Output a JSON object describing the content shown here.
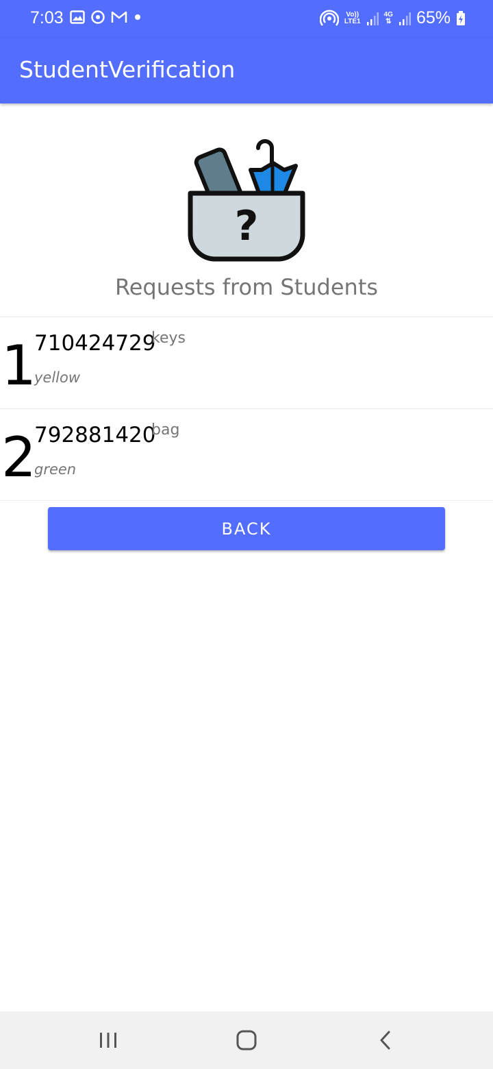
{
  "status_bar": {
    "time": "7:03",
    "left_icons": [
      "gallery-icon",
      "sync-icon",
      "gmail-icon",
      "dot-icon"
    ],
    "right_icons": [
      "hotspot-icon",
      "volte-icon",
      "signal-icon",
      "4g-icon",
      "signal-icon",
      "battery-charging-icon"
    ],
    "volte_label_top": "Vo))",
    "volte_label_bottom": "LTE1",
    "net_label_top": "4G",
    "battery": "65%"
  },
  "app_bar": {
    "title": "StudentVerification"
  },
  "hero": {
    "image": "lost-and-found-box-icon",
    "question_mark": "?"
  },
  "section": {
    "title": "Requests from Students"
  },
  "requests": [
    {
      "index": "1",
      "id": "710424729",
      "item": "keys",
      "color": "yellow"
    },
    {
      "index": "2",
      "id": "792881420",
      "item": "bag",
      "color": "green"
    }
  ],
  "back_button": {
    "label": "BACK"
  },
  "nav_bar": {
    "buttons": [
      "recent-apps-icon",
      "home-icon",
      "back-icon"
    ]
  },
  "colors": {
    "primary": "#536dfe",
    "text_secondary": "#757575",
    "nav_background": "#f1f1f1"
  }
}
